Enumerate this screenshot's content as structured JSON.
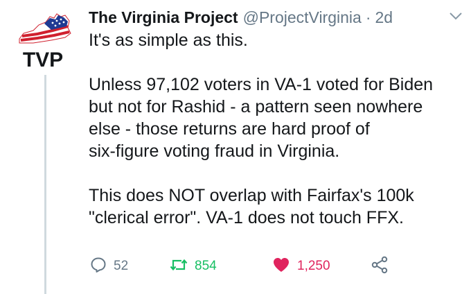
{
  "tweet": {
    "display_name": "The Virginia Project",
    "handle": "@ProjectVirginia",
    "separator": "·",
    "time": "2d",
    "avatar_text": "TVP",
    "body": {
      "line1": "It's as simple as this.",
      "line2": "Unless 97,102 voters in VA-1 voted for Biden",
      "line3": "but not for Rashid - a pattern seen nowhere",
      "line4": "else - those returns are hard proof of",
      "line5": "six-figure voting fraud in Virginia.",
      "line6": "This does NOT overlap with Fairfax's 100k",
      "line7": "\"clerical error\". VA-1 does not touch FFX."
    },
    "actions": {
      "replies": "52",
      "retweets": "854",
      "likes": "1,250"
    }
  },
  "icons": {
    "reply": "reply-icon",
    "retweet": "retweet-icon",
    "like": "heart-icon",
    "share": "share-icon",
    "caret": "chevron-down-icon"
  },
  "colors": {
    "text": "#14171a",
    "secondary": "#657786",
    "retweet": "#17bf63",
    "like": "#e0245e",
    "flag_red": "#d0202e",
    "flag_blue": "#1f3a93"
  }
}
